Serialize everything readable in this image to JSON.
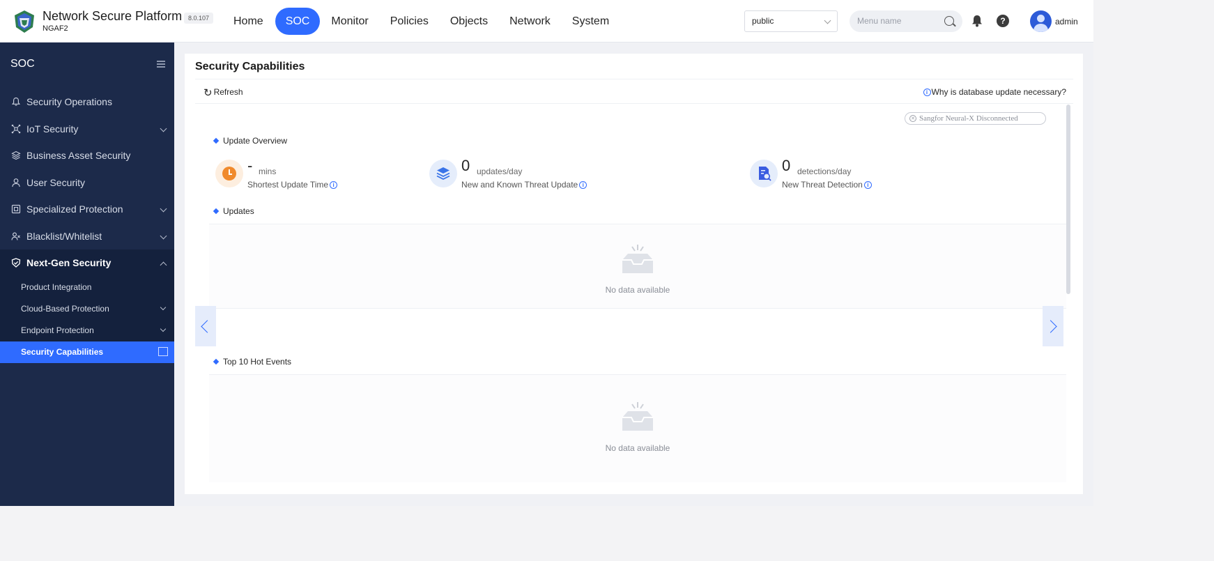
{
  "header": {
    "brand_title": "Network Secure Platform",
    "brand_subtitle": "NGAF2",
    "version": "8.0.107",
    "nav": [
      "Home",
      "SOC",
      "Monitor",
      "Policies",
      "Objects",
      "Network",
      "System"
    ],
    "active_nav": "SOC",
    "tenant": "public",
    "search_placeholder": "Menu name",
    "username": "admin"
  },
  "sidebar": {
    "title": "SOC",
    "items": [
      {
        "label": "Security Operations",
        "icon": "bell-icon"
      },
      {
        "label": "IoT Security",
        "icon": "iot-icon"
      },
      {
        "label": "Business Asset Security",
        "icon": "layers-icon"
      },
      {
        "label": "User Security",
        "icon": "user-icon"
      },
      {
        "label": "Specialized Protection",
        "icon": "shield-grid-icon"
      },
      {
        "label": "Blacklist/Whitelist",
        "icon": "people-icon"
      },
      {
        "label": "Next-Gen Security",
        "icon": "shield-check-icon"
      }
    ],
    "sub_items": [
      {
        "label": "Product Integration"
      },
      {
        "label": "Cloud-Based Protection"
      },
      {
        "label": "Endpoint Protection"
      },
      {
        "label": "Security Capabilities"
      }
    ]
  },
  "main": {
    "title": "Security Capabilities",
    "refresh_label": "Refresh",
    "why_link": "Why is database update necessary?",
    "neural_status": "Sangfor Neural-X Disconnected",
    "overview_heading": "Update Overview",
    "stats": [
      {
        "value": "-",
        "unit": "mins",
        "label": "Shortest Update Time"
      },
      {
        "value": "0",
        "unit": "updates/day",
        "label": "New and Known Threat Update"
      },
      {
        "value": "0",
        "unit": "detections/day",
        "label": "New Threat Detection"
      }
    ],
    "updates_heading": "Updates",
    "updates_empty": "No data available",
    "hot_events_heading": "Top 10 Hot Events",
    "hot_events_empty": "No data available"
  },
  "colors": {
    "accent": "#2f6bff",
    "sidebar_bg": "#1c2a4a",
    "sidebar_sub_bg": "#14213d",
    "orange": "#f08a2c"
  }
}
